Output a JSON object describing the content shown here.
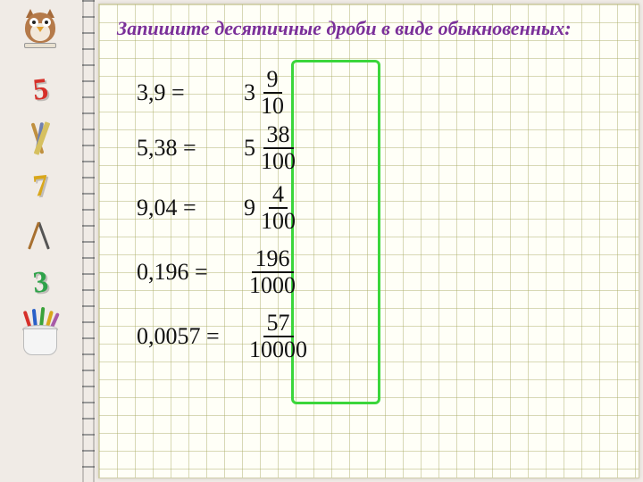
{
  "instruction": "Запишите десятичные дроби в виде обыкновенных:",
  "sidebar": {
    "num5": {
      "text": "5",
      "color": "#d6302a"
    },
    "num7": {
      "text": "7",
      "color": "#d9a71b"
    },
    "num3": {
      "text": "3",
      "color": "#2fa24a"
    }
  },
  "problems": [
    {
      "decimal": "3,9",
      "whole": "3",
      "numerator": "9",
      "denominator": "10"
    },
    {
      "decimal": "5,38",
      "whole": "5",
      "numerator": "38",
      "denominator": "100"
    },
    {
      "decimal": "9,04",
      "whole": "9",
      "numerator": "4",
      "denominator": "100"
    },
    {
      "decimal": "0,196",
      "whole": "",
      "numerator": "196",
      "denominator": "1000"
    },
    {
      "decimal": "0,0057",
      "whole": "",
      "numerator": "57",
      "denominator": "10000"
    }
  ],
  "eq": "="
}
